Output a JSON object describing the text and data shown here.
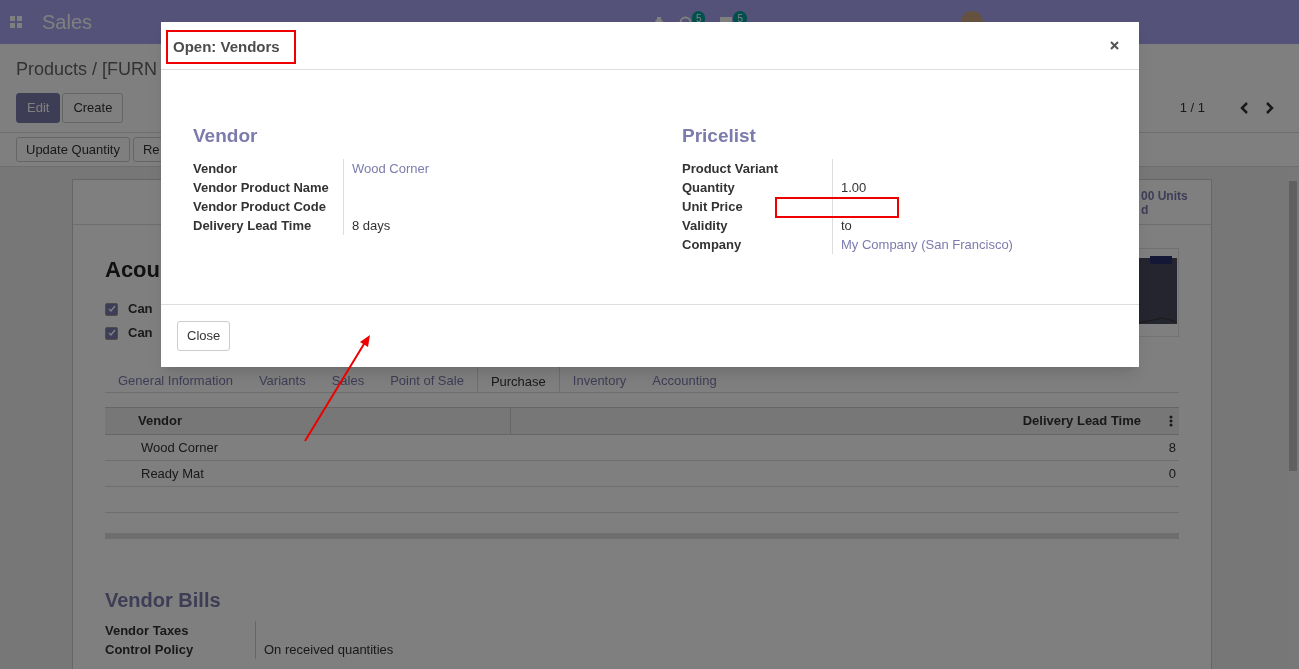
{
  "navbar": {
    "app": "Sales",
    "activity_count": "5",
    "message_count": "5"
  },
  "breadcrumb": "Products / [FURN",
  "buttons": [
    {
      "label": "Edit",
      "kind": "primary"
    },
    {
      "label": "Create",
      "kind": "secondary"
    }
  ],
  "pager": "1 / 1",
  "action_buttons": [
    "Update Quantity",
    "Re"
  ],
  "stat_button": [
    "00 Units",
    "d"
  ],
  "product_title": "Acou",
  "checkboxes": [
    {
      "label": "Can",
      "checked": true
    },
    {
      "label": "Can",
      "checked": true
    }
  ],
  "tabs": [
    {
      "label": "General Information",
      "selected": false
    },
    {
      "label": "Variants",
      "selected": false
    },
    {
      "label": "Sales",
      "selected": false
    },
    {
      "label": "Point of Sale",
      "selected": false
    },
    {
      "label": "Purchase",
      "selected": true
    },
    {
      "label": "Inventory",
      "selected": false
    },
    {
      "label": "Accounting",
      "selected": false
    }
  ],
  "vendor_table": {
    "columns": [
      "Vendor",
      "Delivery Lead Time"
    ],
    "rows": [
      [
        "Wood Corner",
        "8"
      ],
      [
        "Ready Mat",
        "0"
      ]
    ]
  },
  "vendor_bills": {
    "title": "Vendor Bills",
    "fields": [
      {
        "label": "Vendor Taxes"
      },
      {
        "label": "Control Policy",
        "value": "On received quantities"
      }
    ]
  },
  "dialog": {
    "title": "Open: Vendors",
    "groups": [
      {
        "title": "Vendor",
        "fields": [
          {
            "label": "Vendor",
            "value": "Wood Corner",
            "kind": "link"
          },
          {
            "label": "Vendor Product Name"
          },
          {
            "label": "Vendor Product Code"
          },
          {
            "label": "Delivery Lead Time",
            "value": "8 days",
            "kind": "text"
          }
        ]
      },
      {
        "title": "Pricelist",
        "fields": [
          {
            "label": "Product Variant"
          },
          {
            "label": "Quantity",
            "value": "1.00",
            "kind": "text"
          },
          {
            "label": "Unit Price"
          },
          {
            "label": "Validity",
            "value": "to",
            "kind": "text"
          },
          {
            "label": "Company",
            "value": "My Company (San Francisco)",
            "kind": "link"
          }
        ]
      }
    ],
    "close": "Close"
  }
}
